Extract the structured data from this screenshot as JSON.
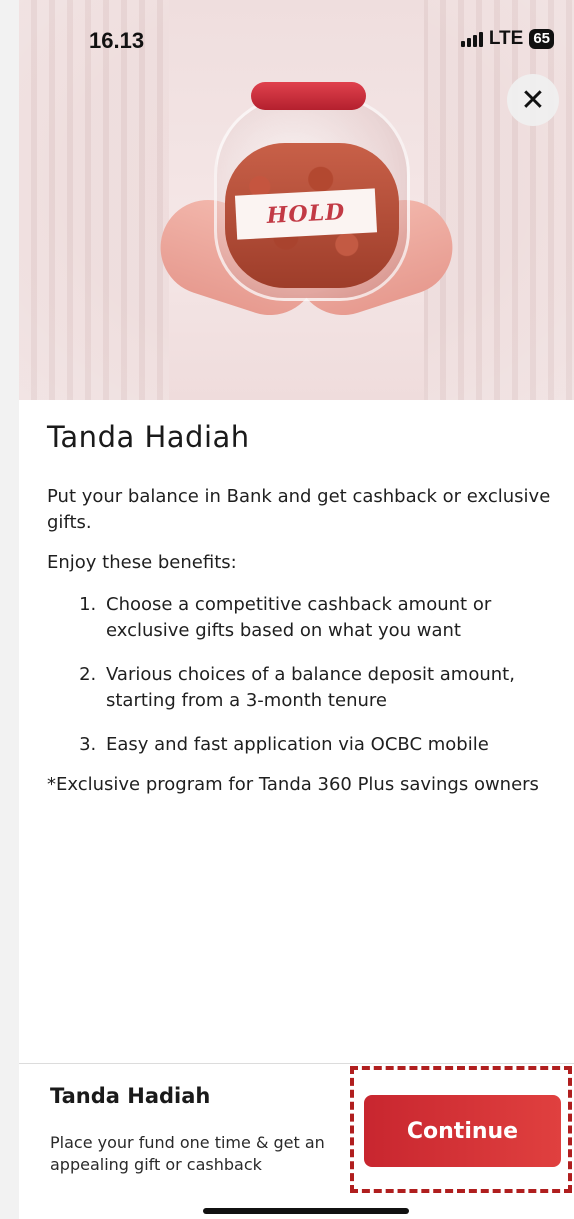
{
  "status_bar": {
    "time": "16.13",
    "network": "LTE",
    "battery": "65"
  },
  "hero": {
    "label_text": "HOLD"
  },
  "close_label": "✕",
  "content": {
    "title": "Tanda Hadiah",
    "intro": "Put your balance in Bank and get cashback or exclusive gifts.",
    "benefits_heading": "Enjoy these benefits:",
    "benefits": [
      "Choose a competitive cashback amount or exclusive gifts based on what you want",
      "Various choices of a balance deposit amount, starting from a 3-month tenure",
      "Easy and fast application via OCBC mobile"
    ],
    "note": "*Exclusive program for Tanda 360 Plus savings owners"
  },
  "bottom_sheet": {
    "title": "Tanda Hadiah",
    "description": "Place your fund one time & get an appealing gift or cashback",
    "continue_label": "Continue"
  },
  "colors": {
    "accent": "#d32f35",
    "highlight": "#b01e1e"
  }
}
